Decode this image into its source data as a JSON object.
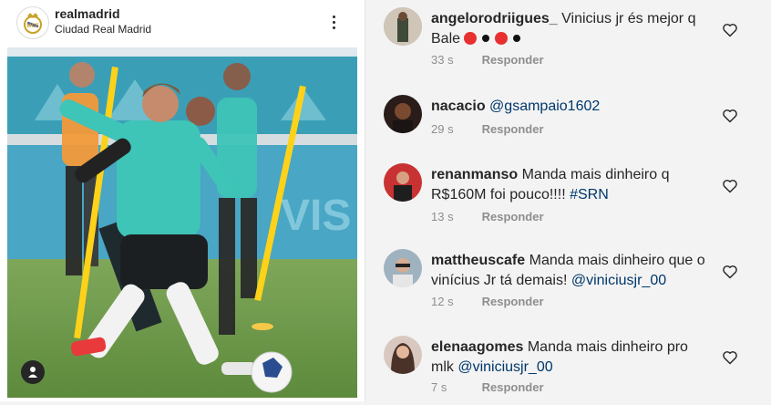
{
  "post": {
    "account": "realmadrid",
    "location": "Ciudad Real Madrid"
  },
  "comments": [
    {
      "user": "angelorodriigues_",
      "text": "Vinicius jr és mejor q Bale",
      "mention": "",
      "emojis": [
        "red-circle",
        "black-circle",
        "red-circle",
        "black-circle"
      ],
      "time": "33 s",
      "reply": "Responder"
    },
    {
      "user": "nacacio",
      "text": "",
      "mention": "@gsampaio1602",
      "emojis": [],
      "time": "29 s",
      "reply": "Responder"
    },
    {
      "user": "renanmanso",
      "text": "Manda mais dinheiro q R$160M foi pouco!!!!",
      "mention": "#SRN",
      "emojis": [],
      "time": "13 s",
      "reply": "Responder"
    },
    {
      "user": "mattheuscafe",
      "text": "Manda mais dinheiro que o vinícius Jr tá demais!",
      "mention": "@viniciusjr_00",
      "emojis": [],
      "time": "12 s",
      "reply": "Responder"
    },
    {
      "user": "elenaagomes",
      "text": "Manda mais dinheiro pro mlk",
      "mention": "@viniciusjr_00",
      "emojis": [],
      "time": "7 s",
      "reply": "Responder"
    }
  ],
  "icons": {
    "more": "more-options-icon",
    "heart": "heart-outline-icon",
    "user_tag": "user-tag-icon"
  },
  "colors": {
    "text": "#262626",
    "muted": "#8e8e8e",
    "mention": "#00376b",
    "jersey": "#3fc4b8"
  }
}
